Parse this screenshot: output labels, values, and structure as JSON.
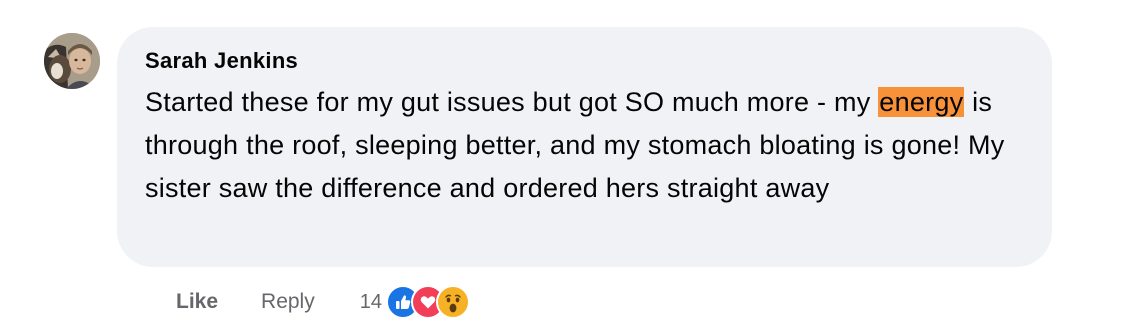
{
  "comment": {
    "author": "Sarah Jenkins",
    "text_before": "Started these for my gut issues but got SO much more - my ",
    "highlight": "energy",
    "text_after": " is through the roof, sleeping better, and my stomach bloating is gone! My sister saw the difference and ordered hers straight away",
    "highlight_color": "#f7923a",
    "bubble_color": "#f0f2f5"
  },
  "actions": {
    "like_label": "Like",
    "reply_label": "Reply",
    "reaction_count": "14",
    "reactions": [
      "like-icon",
      "love-icon",
      "wow-icon"
    ]
  }
}
